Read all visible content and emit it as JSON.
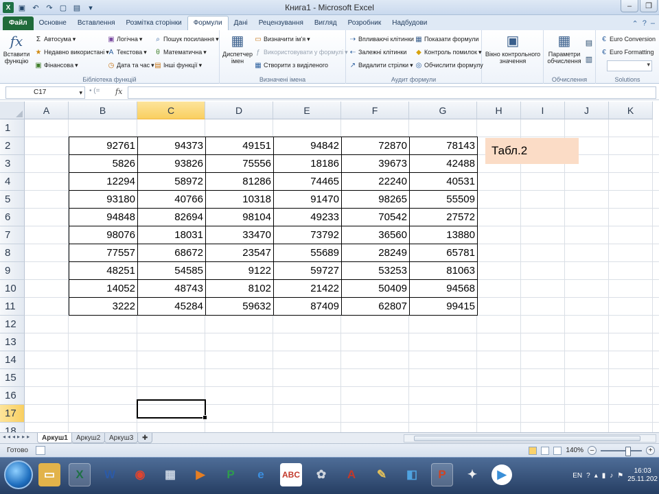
{
  "titlebar": {
    "title": "Книга1  -  Microsoft Excel"
  },
  "tabs": [
    {
      "label": "Файл",
      "id": "file"
    },
    {
      "label": "Основне",
      "id": "home"
    },
    {
      "label": "Вставлення",
      "id": "insert"
    },
    {
      "label": "Розмітка сторінки",
      "id": "layout"
    },
    {
      "label": "Формули",
      "id": "formulas",
      "active": true
    },
    {
      "label": "Дані",
      "id": "data"
    },
    {
      "label": "Рецензування",
      "id": "review"
    },
    {
      "label": "Вигляд",
      "id": "view"
    },
    {
      "label": "Розробник",
      "id": "developer"
    },
    {
      "label": "Надбудови",
      "id": "addins"
    }
  ],
  "ribbon": {
    "insert_function": "Вставити функцію",
    "autosum": "Автосума",
    "recent": "Недавно використані",
    "financial": "Фінансова",
    "logical": "Логічна",
    "text": "Текстова",
    "datetime": "Дата та час",
    "lookup": "Пошук посилання",
    "math": "Математична",
    "other": "Інші функції",
    "group_library": "Бібліотека функцій",
    "name_manager": "Диспетчер імен",
    "define_name": "Визначити ім'я",
    "use_in_formula": "Використовувати у формулі",
    "create_from_selection": "Створити з виділеного",
    "group_names": "Визначені імена",
    "trace_precedents": "Впливаючі клітинки",
    "trace_dependents": "Залежні клітинки",
    "remove_arrows": "Видалити стрілки",
    "show_formulas": "Показати формули",
    "error_checking": "Контроль помилок",
    "evaluate_formula": "Обчислити формулу",
    "watch_window": "Вікно контрольного значення",
    "group_audit": "Аудит формули",
    "calc_options": "Параметри обчислення",
    "group_calc": "Обчислення",
    "euro_conversion": "Euro Conversion",
    "euro_formatting": "Euro Formatting",
    "group_solutions": "Solutions"
  },
  "formula_bar": {
    "name_box": "C17",
    "fx_symbol": "fx",
    "formula": ""
  },
  "columns": [
    "A",
    "B",
    "C",
    "D",
    "E",
    "F",
    "G",
    "H",
    "I",
    "J",
    "K"
  ],
  "selected_column": "C",
  "rows": [
    "1",
    "2",
    "3",
    "4",
    "5",
    "6",
    "7",
    "8",
    "9",
    "10",
    "11",
    "12",
    "13",
    "14",
    "15",
    "16",
    "17",
    "18"
  ],
  "selected_row": "17",
  "table": [
    [
      "92761",
      "94373",
      "49151",
      "94842",
      "72870",
      "78143"
    ],
    [
      "5826",
      "93826",
      "75556",
      "18186",
      "39673",
      "42488"
    ],
    [
      "12294",
      "58972",
      "81286",
      "74465",
      "22240",
      "40531"
    ],
    [
      "93180",
      "40766",
      "10318",
      "91470",
      "98265",
      "55509"
    ],
    [
      "94848",
      "82694",
      "98104",
      "49233",
      "70542",
      "27572"
    ],
    [
      "98076",
      "18031",
      "33470",
      "73792",
      "36560",
      "13880"
    ],
    [
      "77557",
      "68672",
      "23547",
      "55689",
      "28249",
      "65781"
    ],
    [
      "48251",
      "54585",
      "9122",
      "59727",
      "53253",
      "81063"
    ],
    [
      "14052",
      "48743",
      "8102",
      "21422",
      "50409",
      "94568"
    ],
    [
      "3222",
      "45284",
      "59632",
      "87409",
      "62807",
      "99415"
    ]
  ],
  "note": "Табл.2",
  "sheets": [
    {
      "label": "Аркуш1",
      "active": true
    },
    {
      "label": "Аркуш2"
    },
    {
      "label": "Аркуш3"
    }
  ],
  "status": {
    "ready": "Готово",
    "zoom": "140%"
  },
  "taskbar": {
    "language": "EN",
    "time": "16:03",
    "date": "25.11.202"
  },
  "colors": {
    "file_tab": "#1f6b3a",
    "selection_header": "#f9cf60",
    "note_fill": "#fbdcc6"
  }
}
